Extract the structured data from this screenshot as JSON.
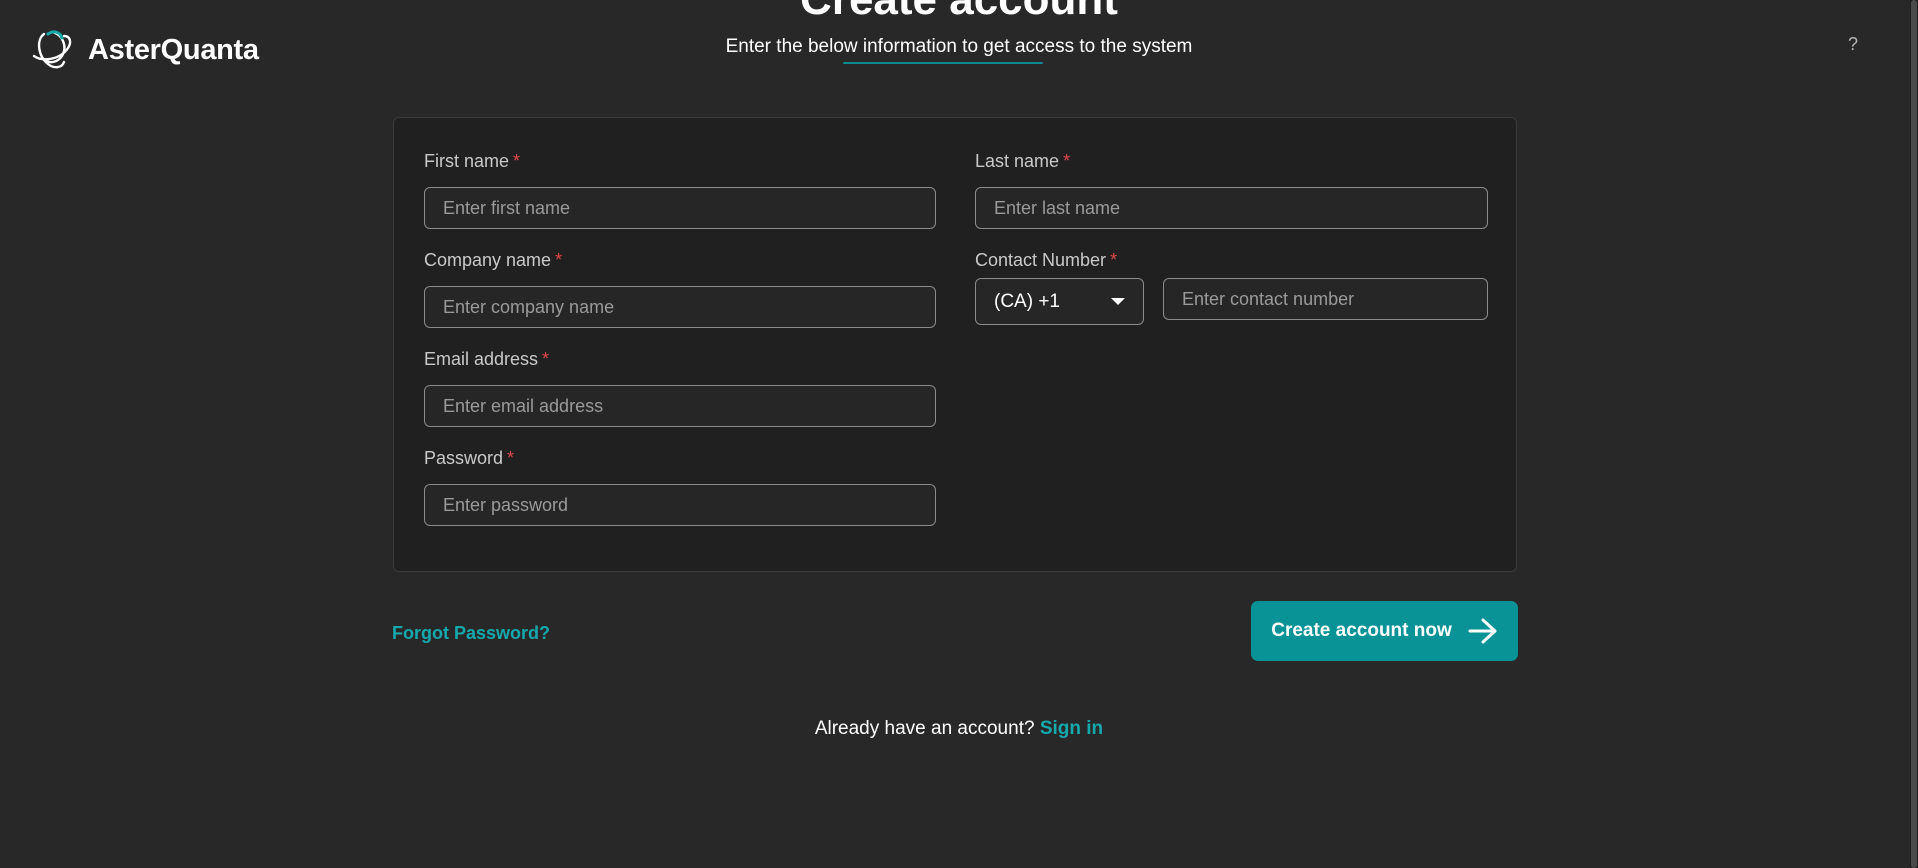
{
  "brand": {
    "name": "AsterQuanta",
    "icon": "asterquanta-logo-icon"
  },
  "header": {
    "title": "Create account",
    "subtitle": "Enter the below information to get access to the system",
    "help_label": "?"
  },
  "form": {
    "first_name": {
      "label": "First name",
      "required": "*",
      "placeholder": "Enter first name",
      "value": ""
    },
    "last_name": {
      "label": "Last name",
      "required": "*",
      "placeholder": "Enter last name",
      "value": ""
    },
    "company_name": {
      "label": "Company name",
      "required": "*",
      "placeholder": "Enter company name",
      "value": ""
    },
    "contact_number": {
      "label": "Contact Number",
      "required": "*",
      "country_code": "(CA) +1",
      "placeholder": "Enter contact number",
      "value": ""
    },
    "email": {
      "label": "Email address",
      "required": "*",
      "placeholder": "Enter email address",
      "value": ""
    },
    "password": {
      "label": "Password",
      "required": "*",
      "placeholder": "Enter password",
      "value": ""
    }
  },
  "actions": {
    "forgot_password": "Forgot Password?",
    "create_account": "Create account now",
    "create_account_icon": "arrow-right-icon"
  },
  "footer": {
    "prompt": "Already have an account?",
    "sign_in": "Sign in"
  },
  "colors": {
    "accent": "#0a9396",
    "link": "#15a9ad",
    "required": "#e0474c",
    "background": "#282828",
    "card": "#202020"
  }
}
